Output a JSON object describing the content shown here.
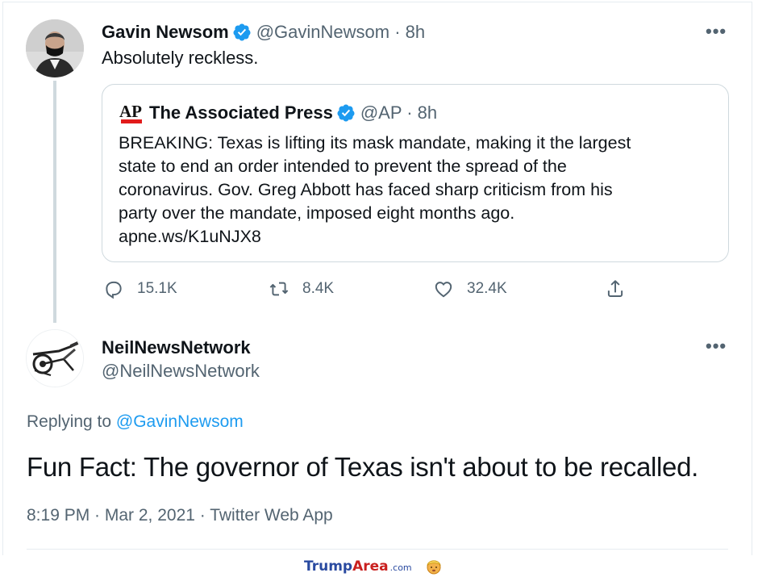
{
  "tweet1": {
    "name": "Gavin Newsom",
    "handle_time": "@GavinNewsom · 8h",
    "text": "Absolutely reckless.",
    "more": "•••"
  },
  "quote": {
    "logo_text": "AP",
    "name": "The Associated Press",
    "handle_time": "@AP · 8h",
    "lines": [
      "BREAKING: Texas is lifting its mask mandate, making it the largest",
      "state to end an order intended to prevent the spread of the",
      "coronavirus. Gov. Greg Abbott has faced sharp criticism from his",
      "party over the mandate, imposed eight months ago.",
      "apne.ws/K1uNJX8"
    ]
  },
  "actions": {
    "replies": "15.1K",
    "retweets": "8.4K",
    "likes": "32.4K"
  },
  "tweet2": {
    "name": "NeilNewsNetwork",
    "handle": "@NeilNewsNetwork",
    "replying_prefix": "Replying to",
    "replying_mention": "@GavinNewsom",
    "text": "Fun Fact: The governor of Texas isn't about to be recalled.",
    "meta": "8:19 PM · Mar 2, 2021 · Twitter Web App",
    "more": "•••"
  },
  "watermark": {
    "trump": "Trump",
    "area": "Area",
    "com": ".com"
  },
  "colors": {
    "verified": "#1d9bf0",
    "link": "#1d9bf0",
    "muted": "#536471",
    "border": "#cfd9de",
    "ap_red": "#e21b1b"
  }
}
